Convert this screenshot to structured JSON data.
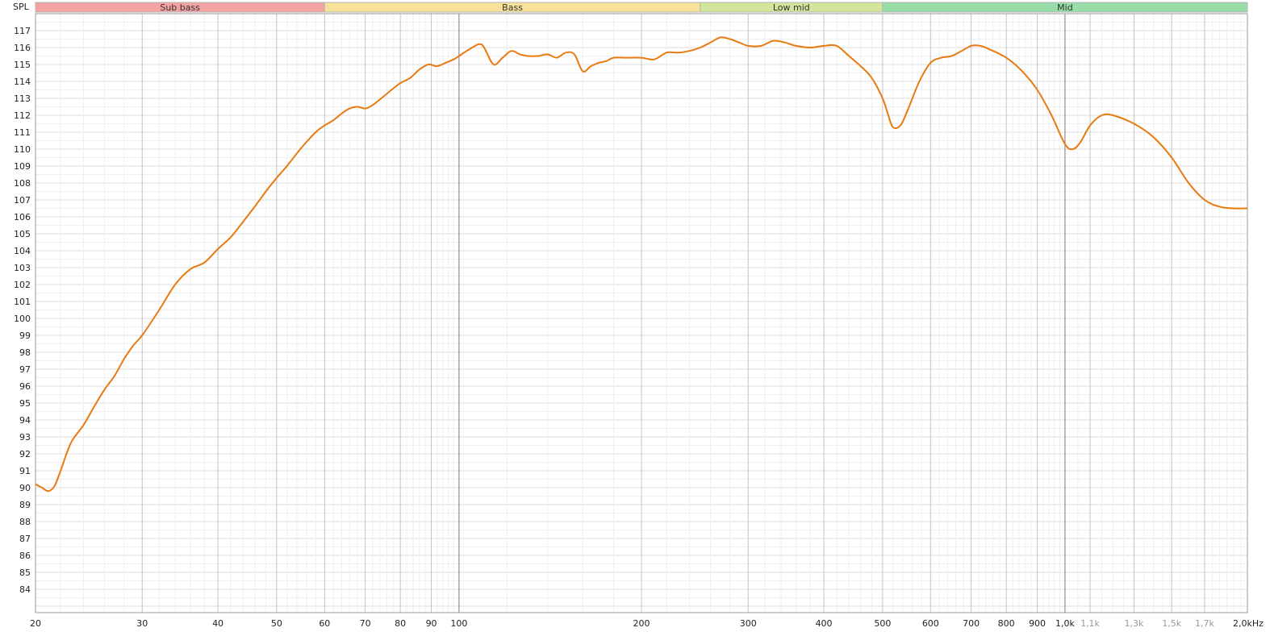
{
  "chart_data": {
    "type": "line",
    "ylabel": "SPL",
    "xunit_label": "2,0kHz",
    "xscale": "log",
    "xlim": [
      20,
      2000
    ],
    "ylim": [
      83,
      117.5
    ],
    "grid": true,
    "yticks": [
      84,
      85,
      86,
      87,
      88,
      89,
      90,
      91,
      92,
      93,
      94,
      95,
      96,
      97,
      98,
      99,
      100,
      101,
      102,
      103,
      104,
      105,
      106,
      107,
      108,
      109,
      110,
      111,
      112,
      113,
      114,
      115,
      116,
      117
    ],
    "xticks_major": [
      {
        "value": 20,
        "label": "20"
      },
      {
        "value": 30,
        "label": "30"
      },
      {
        "value": 40,
        "label": "40"
      },
      {
        "value": 50,
        "label": "50"
      },
      {
        "value": 60,
        "label": "60"
      },
      {
        "value": 70,
        "label": "70"
      },
      {
        "value": 80,
        "label": "80"
      },
      {
        "value": 90,
        "label": "90"
      },
      {
        "value": 100,
        "label": "100"
      },
      {
        "value": 200,
        "label": "200"
      },
      {
        "value": 300,
        "label": "300"
      },
      {
        "value": 400,
        "label": "400"
      },
      {
        "value": 500,
        "label": "500"
      },
      {
        "value": 600,
        "label": "600"
      },
      {
        "value": 700,
        "label": "700"
      },
      {
        "value": 800,
        "label": "800"
      },
      {
        "value": 900,
        "label": "900"
      },
      {
        "value": 1000,
        "label": "1,0k"
      }
    ],
    "xticks_minor": [
      {
        "value": 1100,
        "label": "1,1k"
      },
      {
        "value": 1300,
        "label": "1,3k"
      },
      {
        "value": 1500,
        "label": "1,5k"
      },
      {
        "value": 1700,
        "label": "1,7k"
      }
    ],
    "bands": [
      {
        "label": "Sub bass",
        "from": 20,
        "to": 60,
        "color": "#f4a3a3"
      },
      {
        "label": "Bass",
        "from": 60,
        "to": 250,
        "color": "#f8e29a"
      },
      {
        "label": "Low mid",
        "from": 250,
        "to": 500,
        "color": "#d2e59a"
      },
      {
        "label": "Mid",
        "from": 500,
        "to": 2000,
        "color": "#98dca8"
      }
    ],
    "series": [
      {
        "color": "#e87a10",
        "x": [
          20,
          20.5,
          21,
          21.5,
          22,
          22.5,
          23,
          24,
          25,
          26,
          27,
          28,
          29,
          30,
          32,
          34,
          36,
          38,
          40,
          42,
          44,
          46,
          48,
          50,
          52,
          55,
          58,
          60,
          62,
          64,
          66,
          68,
          70,
          72,
          75,
          78,
          80,
          83,
          86,
          89,
          92,
          95,
          98,
          100,
          104,
          108,
          110,
          114,
          118,
          122,
          126,
          130,
          135,
          140,
          145,
          150,
          155,
          160,
          165,
          170,
          175,
          180,
          190,
          200,
          210,
          220,
          230,
          240,
          250,
          260,
          270,
          280,
          290,
          300,
          315,
          330,
          345,
          360,
          380,
          400,
          420,
          440,
          460,
          480,
          500,
          510,
          520,
          535,
          550,
          575,
          600,
          625,
          650,
          675,
          700,
          725,
          750,
          800,
          850,
          900,
          950,
          1000,
          1030,
          1060,
          1100,
          1150,
          1200,
          1300,
          1400,
          1500,
          1600,
          1700,
          1800,
          1900,
          2000
        ],
        "y": [
          90.2,
          90.0,
          89.8,
          90.1,
          91.0,
          92.0,
          92.8,
          93.7,
          94.8,
          95.8,
          96.6,
          97.6,
          98.4,
          99.0,
          100.5,
          102.0,
          102.9,
          103.3,
          104.1,
          104.8,
          105.7,
          106.6,
          107.5,
          108.3,
          109.0,
          110.1,
          111.0,
          111.4,
          111.7,
          112.1,
          112.4,
          112.5,
          112.4,
          112.6,
          113.1,
          113.6,
          113.9,
          114.2,
          114.7,
          115.0,
          114.9,
          115.1,
          115.3,
          115.5,
          115.9,
          116.2,
          116.0,
          115.0,
          115.4,
          115.8,
          115.6,
          115.5,
          115.5,
          115.6,
          115.4,
          115.7,
          115.6,
          114.6,
          114.9,
          115.1,
          115.2,
          115.4,
          115.4,
          115.4,
          115.3,
          115.7,
          115.7,
          115.8,
          116.0,
          116.3,
          116.6,
          116.5,
          116.3,
          116.1,
          116.1,
          116.4,
          116.3,
          116.1,
          116.0,
          116.1,
          116.1,
          115.5,
          114.9,
          114.2,
          113.0,
          112.1,
          111.3,
          111.4,
          112.3,
          114.0,
          115.1,
          115.4,
          115.5,
          115.8,
          116.1,
          116.1,
          115.9,
          115.4,
          114.6,
          113.5,
          112.0,
          110.3,
          110.0,
          110.4,
          111.4,
          112.0,
          112.0,
          111.5,
          110.7,
          109.5,
          108.0,
          107.0,
          106.6,
          106.5,
          106.5
        ]
      }
    ]
  }
}
